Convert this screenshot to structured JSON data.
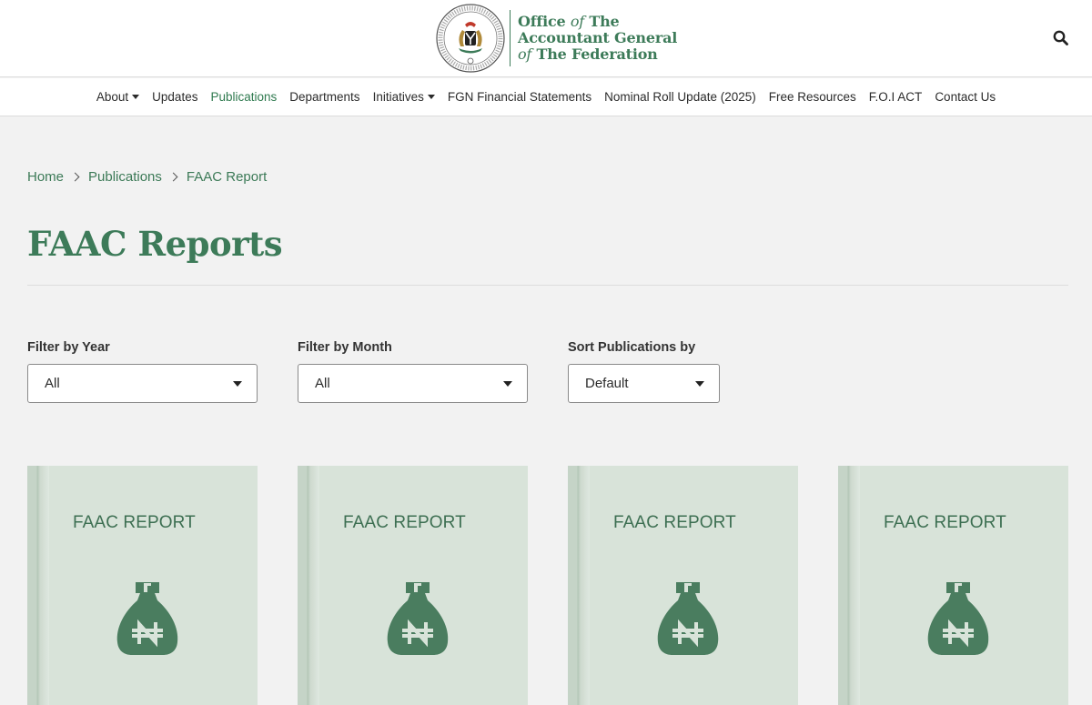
{
  "header": {
    "logo_line1_a": "Office ",
    "logo_line1_b": "of",
    "logo_line1_c": " The",
    "logo_line2": "Accountant General",
    "logo_line3_a": "of",
    "logo_line3_b": " The Federation",
    "search_icon": "search-icon"
  },
  "nav": {
    "items": [
      {
        "label": "About",
        "dropdown": true
      },
      {
        "label": "Updates",
        "dropdown": false
      },
      {
        "label": "Publications",
        "dropdown": false,
        "active": true
      },
      {
        "label": "Departments",
        "dropdown": false
      },
      {
        "label": "Initiatives",
        "dropdown": true
      },
      {
        "label": "FGN Financial Statements",
        "dropdown": false
      },
      {
        "label": "Nominal Roll Update (2025)",
        "dropdown": false
      },
      {
        "label": "Free Resources",
        "dropdown": false
      },
      {
        "label": "F.O.I ACT",
        "dropdown": false
      },
      {
        "label": "Contact Us",
        "dropdown": false
      }
    ]
  },
  "breadcrumb": [
    "Home",
    "Publications",
    "FAAC Report"
  ],
  "page": {
    "title": "FAAC Reports"
  },
  "filters": {
    "year": {
      "label": "Filter by Year",
      "value": "All"
    },
    "month": {
      "label": "Filter by Month",
      "value": "All"
    },
    "sort": {
      "label": "Sort Publications by",
      "value": "Default"
    }
  },
  "cards": [
    {
      "title": "FAAC REPORT",
      "icon": "naira-money-bag-icon"
    },
    {
      "title": "FAAC REPORT",
      "icon": "naira-money-bag-icon"
    },
    {
      "title": "FAAC REPORT",
      "icon": "naira-money-bag-icon"
    },
    {
      "title": "FAAC REPORT",
      "icon": "naira-money-bag-icon"
    }
  ],
  "colors": {
    "brand_green": "#3d7b59",
    "nav_active": "#2f7a4f",
    "card_bg": "#d8e3d9",
    "icon_green": "#4a7d5f",
    "page_bg": "#f2f2f2"
  }
}
